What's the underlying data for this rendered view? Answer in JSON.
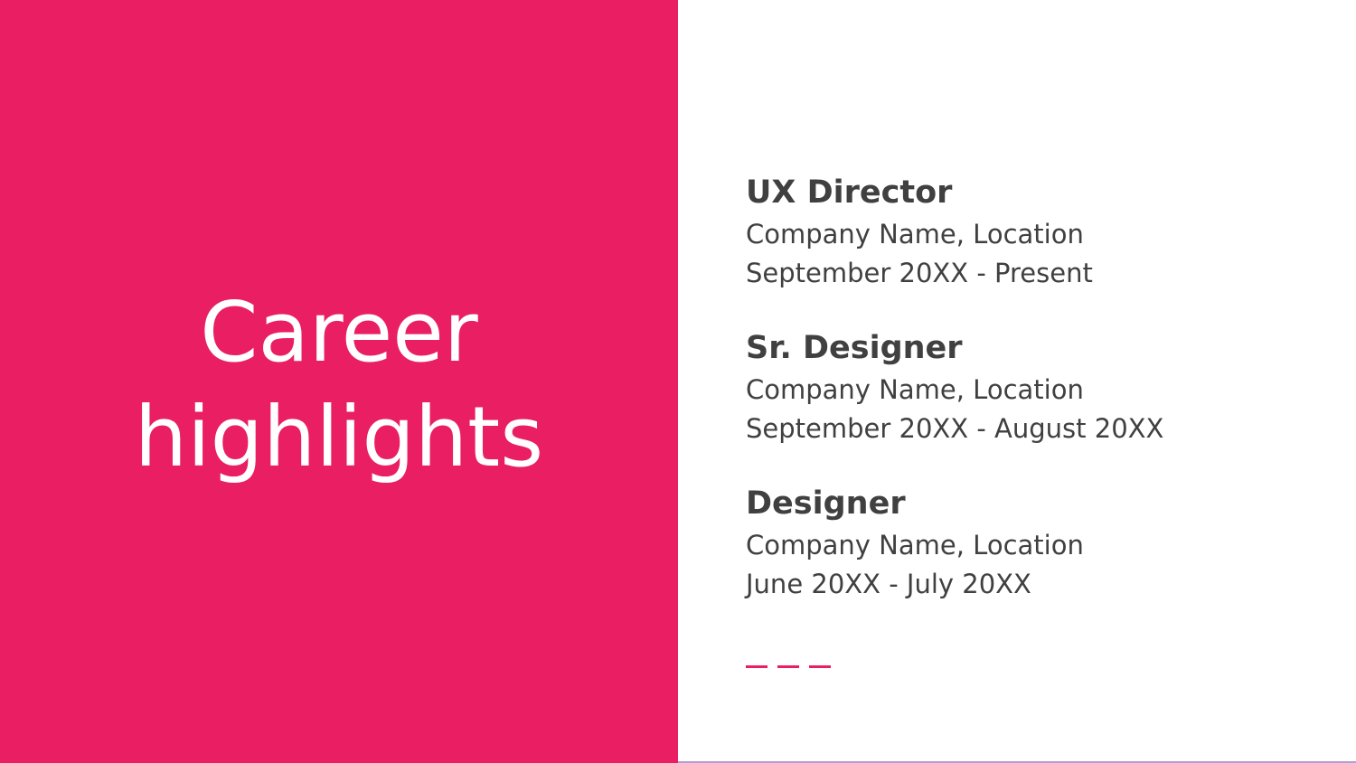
{
  "slide": {
    "title_line1": "Career",
    "title_line2": "highlights",
    "accent_color": "#e91e63",
    "text_color": "#404040"
  },
  "roles": [
    {
      "title": "UX Director",
      "company": "Company Name, Location",
      "dates": "September 20XX - Present"
    },
    {
      "title": "Sr. Designer",
      "company": "Company Name, Location",
      "dates": "September 20XX - August 20XX"
    },
    {
      "title": "Designer",
      "company": "Company Name, Location",
      "dates": "June 20XX - July 20XX"
    }
  ]
}
